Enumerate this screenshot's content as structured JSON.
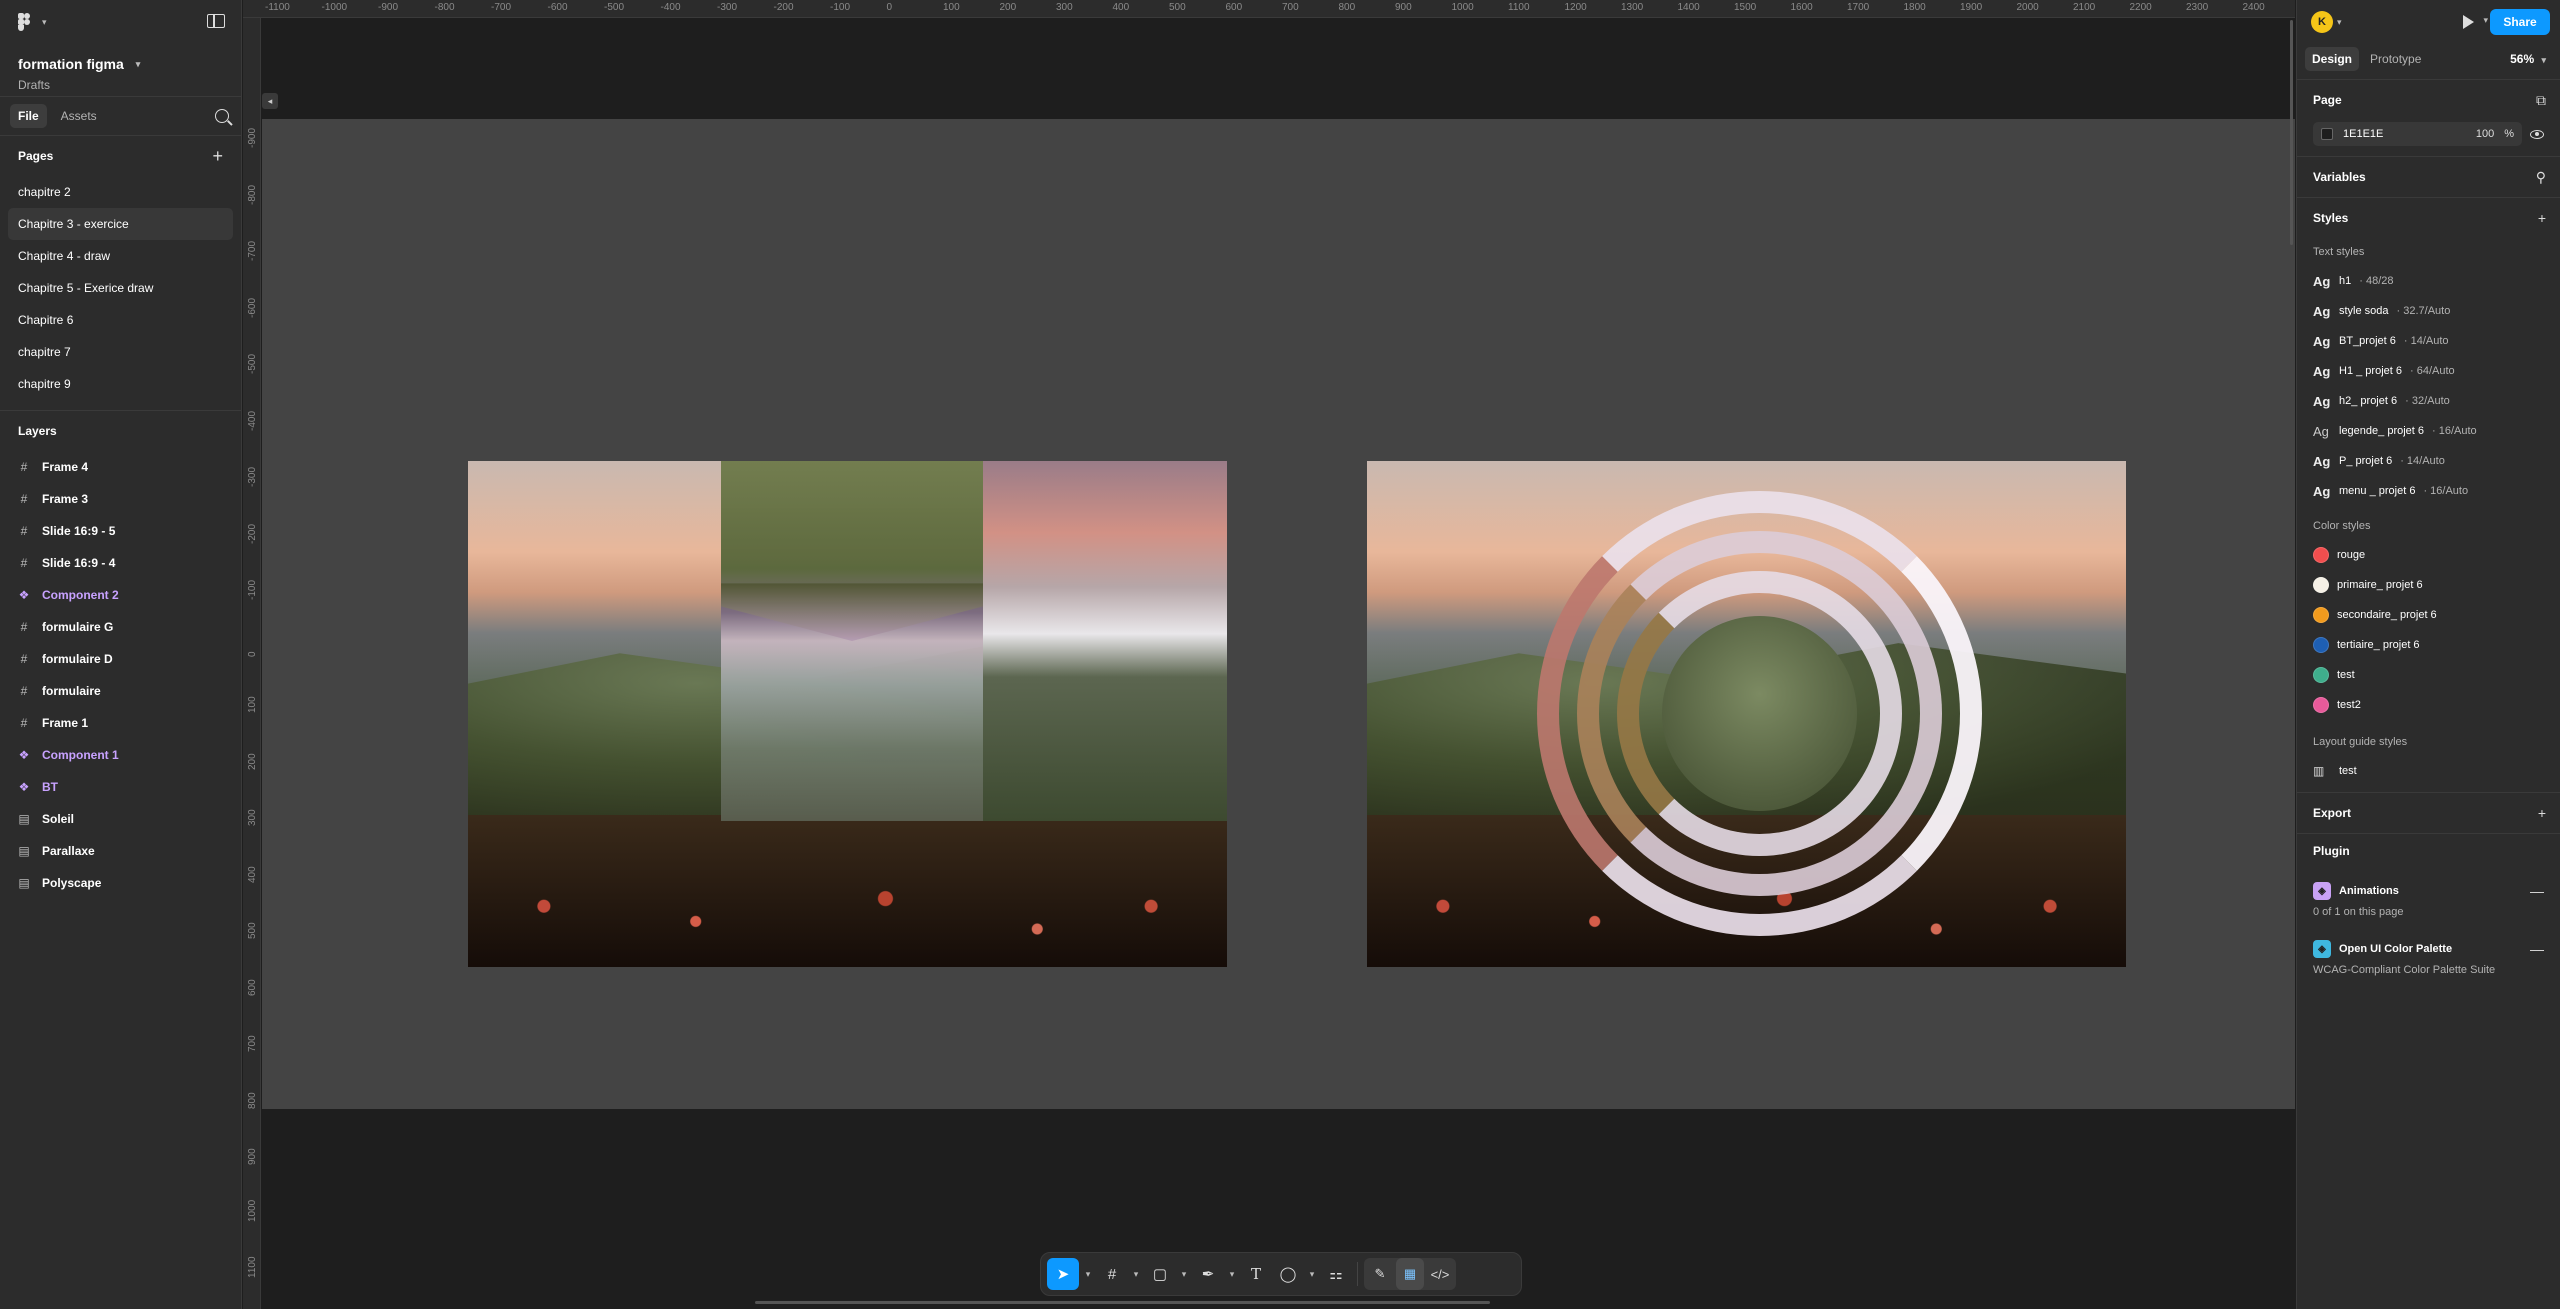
{
  "file": {
    "title": "formation figma",
    "location": "Drafts"
  },
  "left_tabs": [
    "File",
    "Assets"
  ],
  "pages": {
    "header": "Pages",
    "items": [
      "chapitre 2",
      "Chapitre 3 - exercice",
      "Chapitre 4 - draw",
      "Chapitre 5 - Exerice draw",
      "Chapitre 6",
      "chapitre 7",
      "chapitre 9"
    ],
    "selected_index": 1
  },
  "layers": {
    "header": "Layers",
    "items": [
      {
        "name": "Frame 4",
        "kind": "frame"
      },
      {
        "name": "Frame 3",
        "kind": "frame"
      },
      {
        "name": "Slide 16:9 - 5",
        "kind": "frame"
      },
      {
        "name": "Slide 16:9 - 4",
        "kind": "frame"
      },
      {
        "name": "Component 2",
        "kind": "component"
      },
      {
        "name": "formulaire G",
        "kind": "frame"
      },
      {
        "name": "formulaire D",
        "kind": "frame"
      },
      {
        "name": "formulaire",
        "kind": "frame"
      },
      {
        "name": "Frame 1",
        "kind": "frame"
      },
      {
        "name": "Component 1",
        "kind": "component"
      },
      {
        "name": "BT",
        "kind": "component"
      },
      {
        "name": "Soleil",
        "kind": "section"
      },
      {
        "name": "Parallaxe",
        "kind": "section"
      },
      {
        "name": "Polyscape",
        "kind": "section"
      }
    ]
  },
  "ruler_top": [
    "-1100",
    "-1000",
    "-900",
    "-800",
    "-700",
    "-600",
    "-500",
    "-400",
    "-300",
    "-200",
    "-100",
    "0",
    "100",
    "200",
    "300",
    "400",
    "500",
    "600",
    "700",
    "800",
    "900",
    "1000",
    "1100",
    "1200",
    "1300",
    "1400",
    "1500",
    "1600",
    "1700",
    "1800",
    "1900",
    "2000",
    "2100",
    "2200",
    "2300",
    "2400"
  ],
  "ruler_left": [
    "-900",
    "-800",
    "-700",
    "-600",
    "-500",
    "-400",
    "-300",
    "-200",
    "-100",
    "0",
    "100",
    "200",
    "300",
    "400",
    "500",
    "600",
    "700",
    "800",
    "900",
    "1000",
    "1100",
    "1200"
  ],
  "toolbar": {
    "tools": [
      "move-tool",
      "frame-tool",
      "shape-tool",
      "pen-tool",
      "text-tool",
      "comment-tool",
      "actions-tool"
    ],
    "modes": [
      "draw-mode",
      "design-mode",
      "dev-mode"
    ]
  },
  "right": {
    "avatar_initial": "K",
    "share_label": "Share",
    "tabs": [
      "Design",
      "Prototype"
    ],
    "zoom": "56%",
    "page": {
      "header": "Page",
      "bg_color": "1E1E1E",
      "opacity": "100",
      "pct": "%"
    },
    "variables_header": "Variables",
    "styles_header": "Styles",
    "text_styles_header": "Text styles",
    "text_styles": [
      {
        "name": "h1",
        "meta": " · 48/28"
      },
      {
        "name": "style soda",
        "meta": " · 32.7/Auto"
      },
      {
        "name": "BT_projet 6",
        "meta": " · 14/Auto"
      },
      {
        "name": "H1 _ projet 6",
        "meta": " · 64/Auto"
      },
      {
        "name": "h2_ projet 6",
        "meta": " · 32/Auto"
      },
      {
        "name": "legende_ projet 6",
        "meta": " · 16/Auto"
      },
      {
        "name": "P_ projet 6",
        "meta": " · 14/Auto"
      },
      {
        "name": "menu _ projet 6",
        "meta": " · 16/Auto"
      }
    ],
    "ag_label": "Ag",
    "color_styles_header": "Color styles",
    "color_styles": [
      {
        "name": "rouge",
        "color": "#f24e4e"
      },
      {
        "name": "primaire_ projet 6",
        "color": "#f5f0e6"
      },
      {
        "name": "secondaire_ projet 6",
        "color": "#f29b1d"
      },
      {
        "name": "tertiaire_ projet 6",
        "color": "#1e5fb3"
      },
      {
        "name": "test",
        "color": "#3fae8c"
      },
      {
        "name": "test2",
        "color": "#e85a9a"
      }
    ],
    "layout_guide_header": "Layout guide styles",
    "layout_guides": [
      "test"
    ],
    "export_header": "Export",
    "plugin_header": "Plugin",
    "plugins": [
      {
        "name": "Animations",
        "sub": "0 of 1 on this page",
        "color": "#c9a2f5"
      },
      {
        "name": "Open UI Color Palette",
        "sub": "WCAG-Compliant Color Palette Suite",
        "color": "#3fb8e0"
      }
    ]
  },
  "help_label": "?"
}
